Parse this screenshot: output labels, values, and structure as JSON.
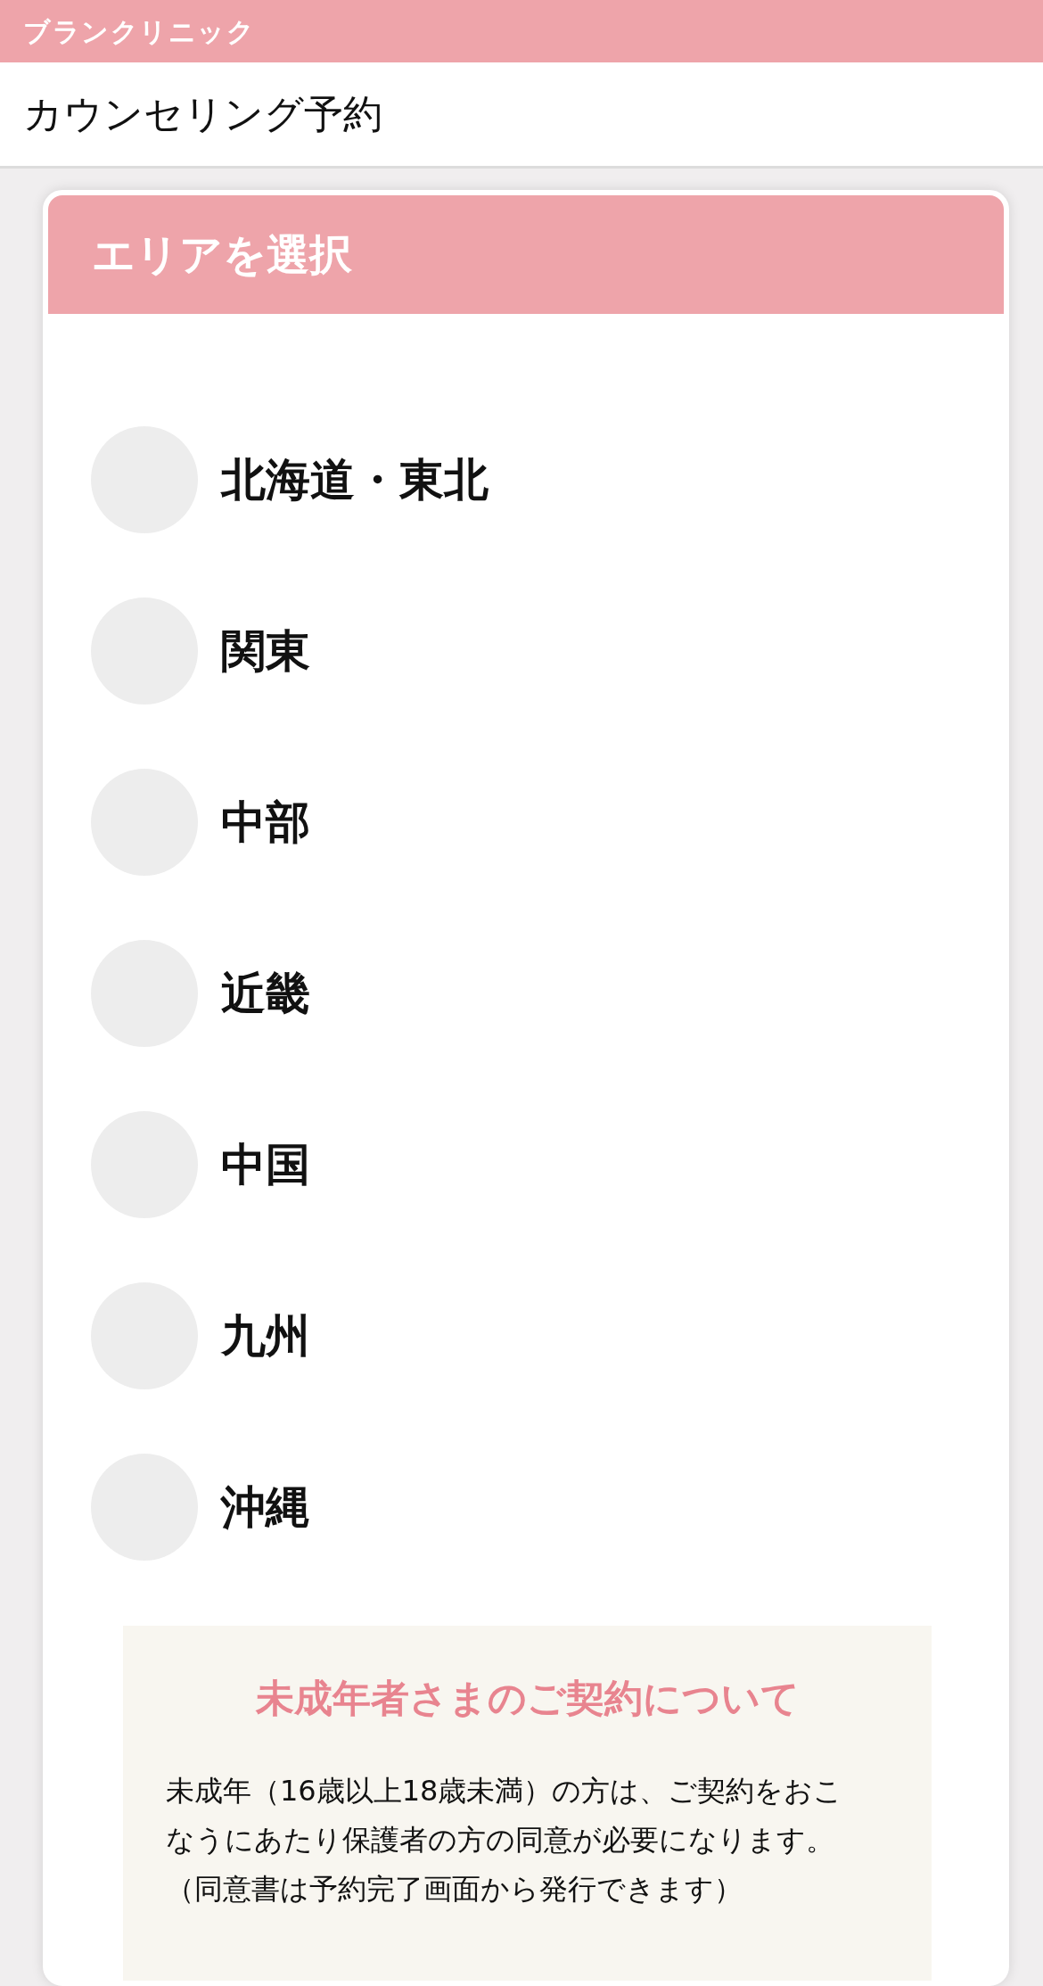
{
  "top_bar": {
    "title": "ブランクリニック"
  },
  "header": {
    "title": "カウンセリング予約"
  },
  "area_card": {
    "title": "エリアを選択",
    "areas": [
      {
        "label": "北海道・東北",
        "selected": false
      },
      {
        "label": "関東",
        "selected": false
      },
      {
        "label": "中部",
        "selected": false
      },
      {
        "label": "近畿",
        "selected": false
      },
      {
        "label": "中国",
        "selected": false
      },
      {
        "label": "九州",
        "selected": false
      },
      {
        "label": "沖縄",
        "selected": false
      }
    ]
  },
  "notice": {
    "title": "未成年者さまのご契約について",
    "body": [
      "未成年（16歳以上18歳未満）の方は、ご契約をおこなうにあたり保護者の方の同意が必要になります。",
      "（同意書は予約完了画面から発行できます）"
    ]
  }
}
